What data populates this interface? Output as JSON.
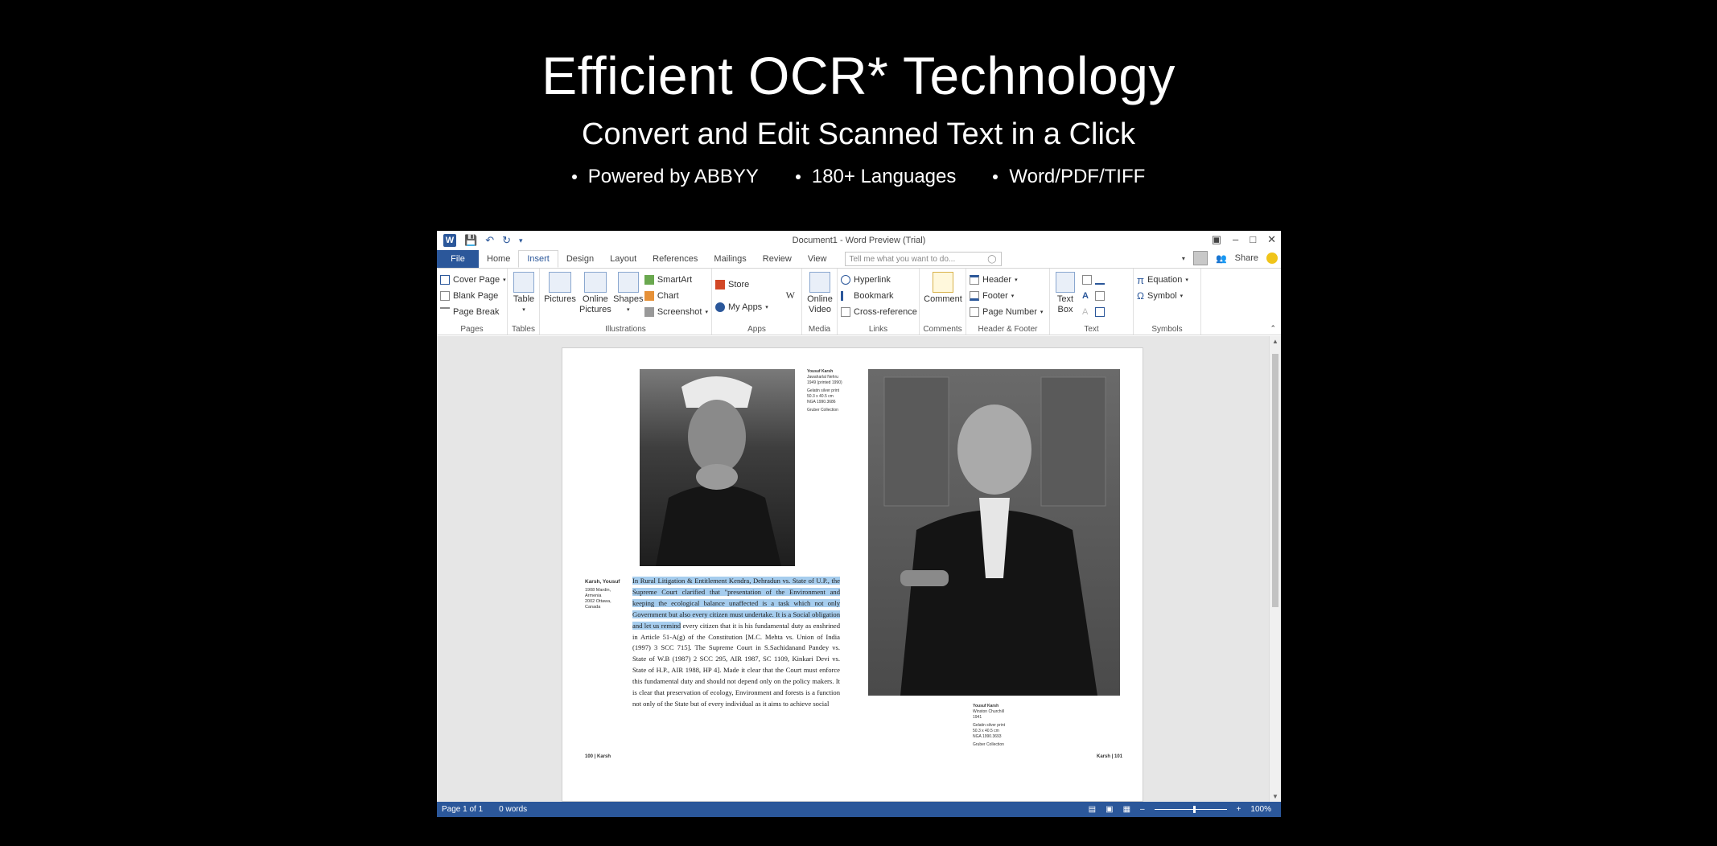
{
  "banner": {
    "headline": "Efficient OCR* Technology",
    "subline": "Convert and Edit Scanned Text in a Click",
    "bullets": [
      "Powered by ABBYY",
      "180+ Languages",
      "Word/PDF/TIFF"
    ]
  },
  "window": {
    "title": "Document1 - Word Preview (Trial)",
    "tabs": [
      "File",
      "Home",
      "Insert",
      "Design",
      "Layout",
      "References",
      "Mailings",
      "Review",
      "View"
    ],
    "active_tab": "Insert",
    "tell_me_placeholder": "Tell me what you want to do...",
    "share_label": "Share",
    "accent_color": "#2b579a"
  },
  "ribbon": {
    "pages": {
      "label": "Pages",
      "items": [
        "Cover Page",
        "Blank Page",
        "Page Break"
      ]
    },
    "tables": {
      "label": "Tables",
      "button": "Table"
    },
    "illustrations": {
      "label": "Illustrations",
      "pictures": "Pictures",
      "online_pictures_1": "Online",
      "online_pictures_2": "Pictures",
      "shapes": "Shapes",
      "smartart": "SmartArt",
      "chart": "Chart",
      "screenshot": "Screenshot"
    },
    "apps": {
      "label": "Apps",
      "store": "Store",
      "my_apps": "My Apps"
    },
    "media": {
      "label": "Media",
      "online_video_1": "Online",
      "online_video_2": "Video"
    },
    "links": {
      "label": "Links",
      "hyperlink": "Hyperlink",
      "bookmark": "Bookmark",
      "cross_reference": "Cross-reference"
    },
    "comments": {
      "label": "Comments",
      "comment": "Comment"
    },
    "header_footer": {
      "label": "Header & Footer",
      "header": "Header",
      "footer": "Footer",
      "page_number": "Page Number"
    },
    "text": {
      "label": "Text",
      "text_box_1": "Text",
      "text_box_2": "Box"
    },
    "symbols": {
      "label": "Symbols",
      "equation": "Equation",
      "symbol": "Symbol"
    }
  },
  "document": {
    "caption_top": [
      "Yousuf Karsh",
      "Jawaharlal Nehru",
      "1949 (printed 1990)",
      "Gelatin silver print",
      "50.3 x 40.5 cm",
      "NGA 1990.3686",
      "Gruber Collection"
    ],
    "side_name": "Karsh, Yousuf",
    "side_details": [
      "1908 Mardin,",
      "Armenia",
      "2002 Ottawa,",
      "Canada"
    ],
    "paragraph_highlighted": "In Rural Litigation & Entitlement Kendra, Dehradun vs. State of U.P., the Supreme Court clarified that \"presentation of the Environment and keeping the ecological balance unaffected is a task which not only Government but also every citizen must undertake. It is a Social obligation and let us remind",
    "paragraph_rest": " every citizen that it is his fundamental duty as enshrined in Article 51-A(g) of the Constitution [M.C. Mehta vs. Union of India (1997) 3 SCC 715]. The Supreme Court in S.Sachidanand Pandey vs. State of W.B (1987) 2 SCC 295, AIR 1987, SC 1109, Kinkari Devi vs. State of H.P., AIR 1988, HP 4]. Made it clear that the Court must enforce this fundamental duty and should not depend only on the policy makers. It is clear that preservation of ecology, Environment and forests is a function not only of the State but of every individual as it aims to achieve social",
    "caption_bottom": [
      "Yousuf Karsh",
      "Winston Churchill",
      "1941",
      "Gelatin silver print",
      "50.3 x 40.5 cm",
      "NGA 1990.3693",
      "Gruber Collection"
    ],
    "footer_left": "100 | Karsh",
    "footer_right": "Karsh | 101"
  },
  "status": {
    "page": "Page 1 of 1",
    "words": "0 words",
    "zoom": "100%"
  }
}
